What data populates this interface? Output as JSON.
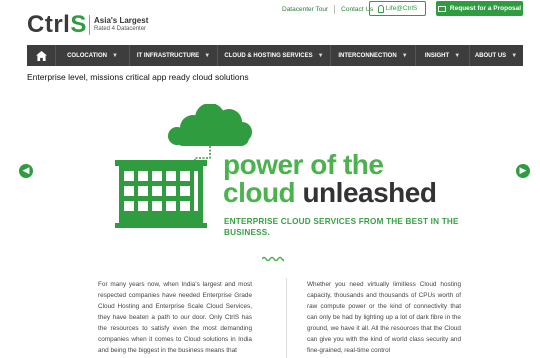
{
  "brand": {
    "logo_text": "Ctrl",
    "logo_s": "S",
    "tagline_main": "Asia's Largest",
    "tagline_sub": "Rated 4 Datacenter"
  },
  "toplinks": {
    "tour": "Datacenter Tour",
    "contact": "Contact Us",
    "life": "Life@CtrlS",
    "proposal": "Request for a Proposal"
  },
  "nav": {
    "items": [
      {
        "label": "COLOCATION"
      },
      {
        "label": "IT INFRASTRUCTURE"
      },
      {
        "label": "CLOUD & HOSTING SERVICES"
      },
      {
        "label": "INTERCONNECTION"
      },
      {
        "label": "INSIGHT"
      },
      {
        "label": "ABOUT US"
      }
    ]
  },
  "headline": "Enterprise level, missions critical app ready cloud solutions",
  "hero": {
    "line1": "power of the",
    "line2_green": "cloud",
    "line2_dark": "unleashed",
    "tagline": "ENTERPRISE CLOUD SERVICES FROM THE BEST IN THE BUSINESS.",
    "accent_color": "#2e9c3f"
  },
  "body": {
    "left": "For many years now, when India's largest and most respected companies have needed Enterprise Grade Cloud Hosting and Enterprise Scale Cloud Services, they have beaten a path to our door. Only CtrlS has the resources to satisfy even the most demanding companies when it comes to Cloud solutions in India and being the biggest in the business means that",
    "right": "Whether you need virtually limitless Cloud hosting capacity, thousands and thousands of CPUs worth of raw compute power or the kind of connectivity that can only be had by lighting up a lot of dark fibre in the ground, we have it all. All the resources that the Cloud can give you with the kind of world class security and fine-grained, real-time control"
  }
}
